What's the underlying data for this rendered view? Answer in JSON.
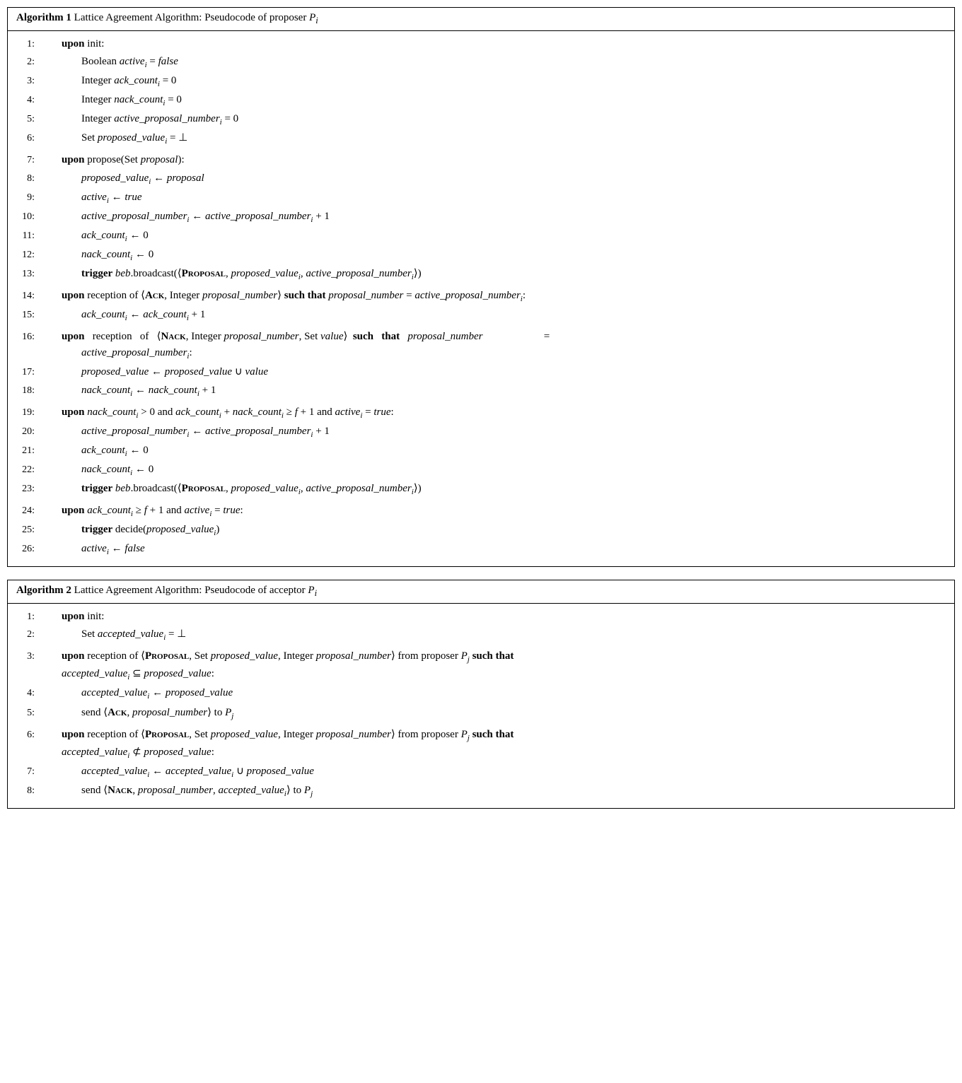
{
  "algorithms": [
    {
      "id": "algo1",
      "label": "Algorithm 1",
      "title": "Lattice Agreement Algorithm: Pseudocode of proposer",
      "P_sub": "i",
      "lines": [
        {
          "num": "1:",
          "indent": 1,
          "html": "<span class='kw'>upon</span> init:"
        },
        {
          "num": "2:",
          "indent": 2,
          "html": "Boolean <span class='it'>active<sub class='sub'>i</sub></span> = <span class='it'>false</span>"
        },
        {
          "num": "3:",
          "indent": 2,
          "html": "Integer <span class='it'>ack_count<sub class='sub'>i</sub></span> = 0"
        },
        {
          "num": "4:",
          "indent": 2,
          "html": "Integer <span class='it'>nack_count<sub class='sub'>i</sub></span> = 0"
        },
        {
          "num": "5:",
          "indent": 2,
          "html": "Integer <span class='it'>active_proposal_number<sub class='sub'>i</sub></span> = 0"
        },
        {
          "num": "6:",
          "indent": 2,
          "html": "Set <span class='it'>proposed_value<sub class='sub'>i</sub></span> = ⊥"
        },
        {
          "num": "",
          "indent": 0,
          "html": ""
        },
        {
          "num": "7:",
          "indent": 1,
          "html": "<span class='kw'>upon</span> propose(Set <span class='it'>proposal</span>):"
        },
        {
          "num": "8:",
          "indent": 2,
          "html": "<span class='it'>proposed_value<sub class='sub'>i</sub></span> ← <span class='it'>proposal</span>"
        },
        {
          "num": "9:",
          "indent": 2,
          "html": "<span class='it'>active<sub class='sub'>i</sub></span> ← <span class='it'>true</span>"
        },
        {
          "num": "10:",
          "indent": 2,
          "html": "<span class='it'>active_proposal_number<sub class='sub'>i</sub></span> ← <span class='it'>active_proposal_number<sub class='sub'>i</sub></span> + 1"
        },
        {
          "num": "11:",
          "indent": 2,
          "html": "<span class='it'>ack_count<sub class='sub'>i</sub></span> ← 0"
        },
        {
          "num": "12:",
          "indent": 2,
          "html": "<span class='it'>nack_count<sub class='sub'>i</sub></span> ← 0"
        },
        {
          "num": "13:",
          "indent": 2,
          "html": "<span class='kw'>trigger</span> <span class='it'>beb</span>.broadcast(⟨<span class='sc'>Proposal</span>, <span class='it'>proposed_value<sub class='sub'>i</sub></span>, <span class='it'>active_proposal_number<sub class='sub'>i</sub></span>⟩)"
        },
        {
          "num": "",
          "indent": 0,
          "html": ""
        },
        {
          "num": "14:",
          "indent": 1,
          "html": "<span class='kw'>upon</span> reception of ⟨<span class='sc'>Ack</span>, Integer <span class='it'>proposal_number</span>⟩ <span class='kw'>such that</span> <span class='it'>proposal_number</span> = <span class='it'>active_proposal_number<sub class='sub'>i</sub></span>:"
        },
        {
          "num": "15:",
          "indent": 2,
          "html": "<span class='it'>ack_count<sub class='sub'>i</sub></span> ← <span class='it'>ack_count<sub class='sub'>i</sub></span> + 1"
        },
        {
          "num": "",
          "indent": 0,
          "html": ""
        },
        {
          "num": "16:",
          "indent": 1,
          "html": "<span class='kw'>upon</span>&nbsp;&nbsp; reception&nbsp;&nbsp; of&nbsp;&nbsp; ⟨<span class='sc'>Nack</span>, Integer <span class='it'>proposal_number</span>, Set <span class='it'>value</span>⟩ &nbsp;<span class='kw'>such</span> &nbsp;&nbsp;<span class='kw'>that</span> &nbsp;&nbsp;<span class='it'>proposal_number</span>&nbsp;&nbsp;&nbsp;&nbsp;&nbsp;&nbsp;&nbsp;&nbsp;&nbsp;&nbsp;&nbsp;&nbsp;&nbsp;&nbsp;&nbsp;&nbsp;&nbsp;&nbsp;&nbsp;&nbsp;&nbsp;&nbsp; =<br><span style='padding-left:28px'><span class='it'>active_proposal_number<sub class='sub'>i</sub></span>:</span>"
        },
        {
          "num": "17:",
          "indent": 2,
          "html": "<span class='it'>proposed_value</span> ← <span class='it'>proposed_value</span> ∪ <span class='it'>value</span>"
        },
        {
          "num": "18:",
          "indent": 2,
          "html": "<span class='it'>nack_count<sub class='sub'>i</sub></span> ← <span class='it'>nack_count<sub class='sub'>i</sub></span> + 1"
        },
        {
          "num": "",
          "indent": 0,
          "html": ""
        },
        {
          "num": "19:",
          "indent": 1,
          "html": "<span class='kw'>upon</span> <span class='it'>nack_count<sub class='sub'>i</sub></span> &gt; 0 and <span class='it'>ack_count<sub class='sub'>i</sub></span> + <span class='it'>nack_count<sub class='sub'>i</sub></span> ≥ <span class='it'>f</span> + 1 and <span class='it'>active<sub class='sub'>i</sub></span> = <span class='it'>true</span>:"
        },
        {
          "num": "20:",
          "indent": 2,
          "html": "<span class='it'>active_proposal_number<sub class='sub'>i</sub></span> ← <span class='it'>active_proposal_number<sub class='sub'>i</sub></span> + 1"
        },
        {
          "num": "21:",
          "indent": 2,
          "html": "<span class='it'>ack_count<sub class='sub'>i</sub></span> ← 0"
        },
        {
          "num": "22:",
          "indent": 2,
          "html": "<span class='it'>nack_count<sub class='sub'>i</sub></span> ← 0"
        },
        {
          "num": "23:",
          "indent": 2,
          "html": "<span class='kw'>trigger</span> <span class='it'>beb</span>.broadcast(⟨<span class='sc'>Proposal</span>, <span class='it'>proposed_value<sub class='sub'>i</sub></span>, <span class='it'>active_proposal_number<sub class='sub'>i</sub></span>⟩)"
        },
        {
          "num": "",
          "indent": 0,
          "html": ""
        },
        {
          "num": "24:",
          "indent": 1,
          "html": "<span class='kw'>upon</span> <span class='it'>ack_count<sub class='sub'>i</sub></span> ≥ <span class='it'>f</span> + 1 and <span class='it'>active<sub class='sub'>i</sub></span> = <span class='it'>true</span>:"
        },
        {
          "num": "25:",
          "indent": 2,
          "html": "<span class='kw'>trigger</span> decide(<span class='it'>proposed_value<sub class='sub'>i</sub></span>)"
        },
        {
          "num": "26:",
          "indent": 2,
          "html": "<span class='it'>active<sub class='sub'>i</sub></span> ← <span class='it'>false</span>"
        }
      ]
    },
    {
      "id": "algo2",
      "label": "Algorithm 2",
      "title": "Lattice Agreement Algorithm: Pseudocode of acceptor",
      "P_sub": "i",
      "lines": [
        {
          "num": "1:",
          "indent": 1,
          "html": "<span class='kw'>upon</span> init:"
        },
        {
          "num": "2:",
          "indent": 2,
          "html": "Set <span class='it'>accepted_value<sub class='sub'>i</sub></span> = ⊥"
        },
        {
          "num": "",
          "indent": 0,
          "html": ""
        },
        {
          "num": "3:",
          "indent": 1,
          "html": "<span class='kw'>upon</span> reception of ⟨<span class='sc'>Proposal</span>, Set <span class='it'>proposed_value</span>, Integer <span class='it'>proposal_number</span>⟩ from proposer <span class='it'>P<sub class='sub'>j</sub></span> <span class='kw'>such that</span><br><span style='padding-left:0px'><span class='it'>accepted_value<sub class='sub'>i</sub></span> ⊆ <span class='it'>proposed_value</span>:</span>"
        },
        {
          "num": "4:",
          "indent": 2,
          "html": "<span class='it'>accepted_value<sub class='sub'>i</sub></span> ← <span class='it'>proposed_value</span>"
        },
        {
          "num": "5:",
          "indent": 2,
          "html": "send ⟨<span class='sc'>Ack</span>, <span class='it'>proposal_number</span>⟩ to <span class='it'>P<sub class='sub'>j</sub></span>"
        },
        {
          "num": "",
          "indent": 0,
          "html": ""
        },
        {
          "num": "6:",
          "indent": 1,
          "html": "<span class='kw'>upon</span> reception of ⟨<span class='sc'>Proposal</span>, Set <span class='it'>proposed_value</span>, Integer <span class='it'>proposal_number</span>⟩ from proposer <span class='it'>P<sub class='sub'>j</sub></span> <span class='kw'>such that</span><br><span style='padding-left:0px'><span class='it'>accepted_value<sub class='sub'>i</sub></span> ⊄ <span class='it'>proposed_value</span>:</span>"
        },
        {
          "num": "7:",
          "indent": 2,
          "html": "<span class='it'>accepted_value<sub class='sub'>i</sub></span> ← <span class='it'>accepted_value<sub class='sub'>i</sub></span> ∪ <span class='it'>proposed_value</span>"
        },
        {
          "num": "8:",
          "indent": 2,
          "html": "send ⟨<span class='sc'>Nack</span>, <span class='it'>proposal_number</span>, <span class='it'>accepted_value<sub class='sub'>i</sub></span>⟩ to <span class='it'>P<sub class='sub'>j</sub></span>"
        }
      ]
    }
  ]
}
